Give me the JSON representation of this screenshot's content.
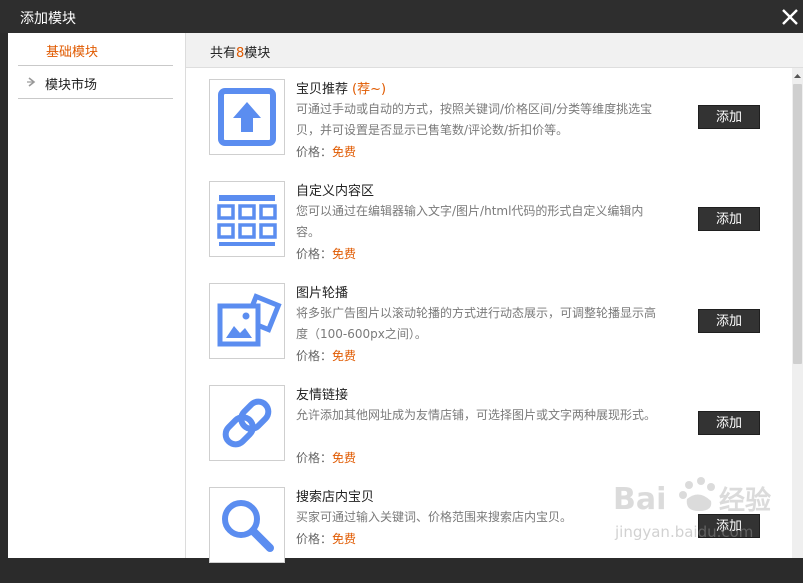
{
  "window": {
    "title": "添加模块"
  },
  "sidebar": {
    "items": [
      {
        "label": "基础模块"
      },
      {
        "label": "模块市场"
      }
    ]
  },
  "main": {
    "header": {
      "prefix": "共有",
      "count": "8",
      "suffix": "模块"
    },
    "modules": [
      {
        "name": "宝贝推荐",
        "tag": "(荐~)",
        "desc": "可通过手动或自动的方式，按照关键词/价格区间/分类等维度挑选宝贝，并可设置是否显示已售笔数/评论数/折扣价等。",
        "price_label": "价格：",
        "price": "免费",
        "add": "添加",
        "icon": "upload-arrow-icon"
      },
      {
        "name": "自定义内容区",
        "tag": "",
        "desc": "您可以通过在编辑器输入文字/图片/html代码的形式自定义编辑内容。",
        "price_label": "价格：",
        "price": "免费",
        "add": "添加",
        "icon": "grid-layout-icon"
      },
      {
        "name": "图片轮播",
        "tag": "",
        "desc": "将多张广告图片以滚动轮播的方式进行动态展示，可调整轮播显示高度（100-600px之间）。",
        "price_label": "价格：",
        "price": "免费",
        "add": "添加",
        "icon": "image-carousel-icon"
      },
      {
        "name": "友情链接",
        "tag": "",
        "desc": "允许添加其他网址成为友情店铺，可选择图片或文字两种展现形式。",
        "price_label": "价格：",
        "price": "免费",
        "add": "添加",
        "icon": "chain-link-icon"
      },
      {
        "name": "搜索店内宝贝",
        "tag": "",
        "desc": "买家可通过输入关键词、价格范围来搜索店内宝贝。",
        "price_label": "价格：",
        "price": "免费",
        "add": "添加",
        "icon": "search-magnifier-icon"
      }
    ]
  },
  "watermark": {
    "logo": "Bai度经验",
    "url": "jingyan.baidu.com"
  },
  "colors": {
    "accent": "#e05a00",
    "icon": "#5b8df0",
    "button": "#333333"
  }
}
